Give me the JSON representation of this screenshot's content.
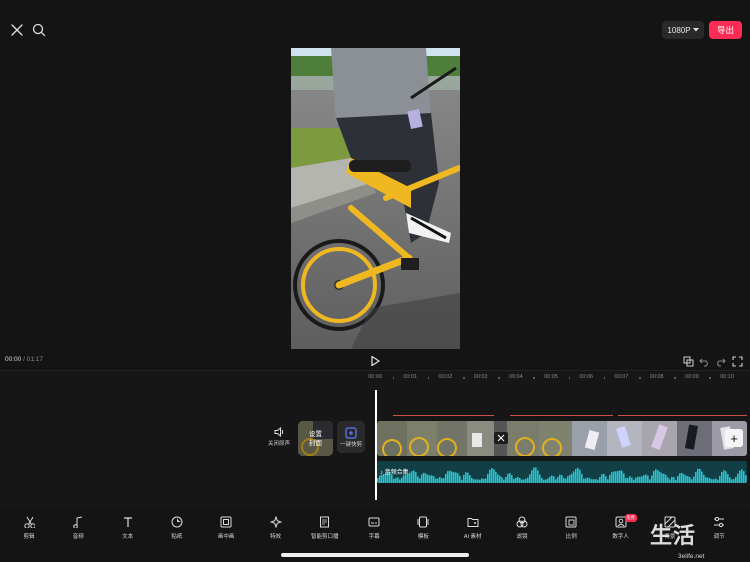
{
  "toolbar_top": {
    "resolution_label": "1080P",
    "export_label": "导出"
  },
  "playback": {
    "current_time": "00:00",
    "separator": " / ",
    "total_time": "01:17"
  },
  "ruler": {
    "ticks": [
      "00:00",
      "00:01",
      "00:02",
      "00:03",
      "00:04",
      "00:05",
      "00:06",
      "00:07",
      "00:08",
      "00:09",
      "00:10"
    ]
  },
  "track_controls": {
    "mute_label": "关闭原声",
    "cover_label": "设置\n封面",
    "quickcut_label": "一键快剪"
  },
  "audio_track": {
    "label": "音频合集"
  },
  "bottom_tools": [
    {
      "name": "cut",
      "label": "剪辑",
      "icon": "scissors-icon"
    },
    {
      "name": "audio",
      "label": "音频",
      "icon": "music-note-icon"
    },
    {
      "name": "text",
      "label": "文本",
      "icon": "text-t-icon"
    },
    {
      "name": "sticker",
      "label": "贴纸",
      "icon": "sticker-icon"
    },
    {
      "name": "pip",
      "label": "画中画",
      "icon": "pip-icon"
    },
    {
      "name": "effects",
      "label": "特效",
      "icon": "sparkle-star-icon"
    },
    {
      "name": "smart-script",
      "label": "智能剪口播",
      "icon": "script-icon"
    },
    {
      "name": "subtitle",
      "label": "字幕",
      "icon": "subtitle-icon"
    },
    {
      "name": "template",
      "label": "模板",
      "icon": "template-icon"
    },
    {
      "name": "ai-material",
      "label": "AI 素材",
      "icon": "ai-folder-icon"
    },
    {
      "name": "filter",
      "label": "滤镜",
      "icon": "filter-icon"
    },
    {
      "name": "ratio",
      "label": "比例",
      "icon": "ratio-icon"
    },
    {
      "name": "digital-human",
      "label": "数字人",
      "icon": "digital-human-icon",
      "badge": "免费"
    },
    {
      "name": "background",
      "label": "背景",
      "icon": "background-icon"
    },
    {
      "name": "adjust",
      "label": "调节",
      "icon": "sliders-icon"
    }
  ],
  "watermark": {
    "logo_text": "生活",
    "url": "3elife.net"
  },
  "colors": {
    "accent": "#fe2c55",
    "audio_wave": "#27c4d0",
    "background": "#141414"
  }
}
